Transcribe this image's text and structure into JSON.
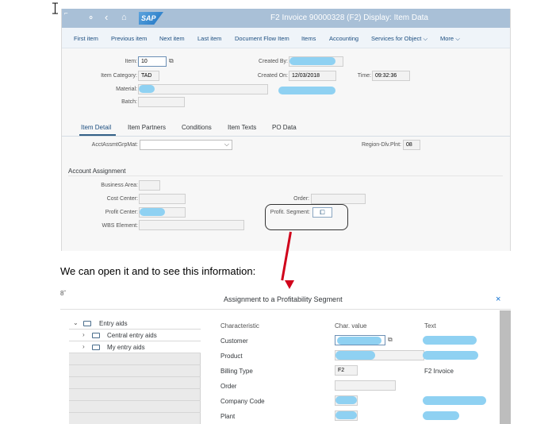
{
  "sap_window": {
    "title": "F2 Invoice 90000328 (F2) Display: Item Data",
    "logo_text": "SAP",
    "toolbar": [
      "First item",
      "Previous item",
      "Next item",
      "Last item",
      "Document Flow Item",
      "Items",
      "Accounting",
      "Services for Object",
      "More"
    ],
    "header": {
      "item_label": "Item:",
      "item_value": "10",
      "item_category_label": "Item Category:",
      "item_category_value": "TAD",
      "material_label": "Material:",
      "batch_label": "Batch:",
      "created_by_label": "Created By:",
      "created_on_label": "Created On:",
      "created_on_value": "12/03/2018",
      "time_label": "Time:",
      "time_value": "09:32:36"
    },
    "tabs": [
      "Item Detail",
      "Item Partners",
      "Conditions",
      "Item Texts",
      "PO Data"
    ],
    "active_tab": "Item Detail",
    "acct_assmt_label": "AcctAssmtGrpMat:",
    "region_label": "Region-Dlv.Plnt:",
    "region_value": "08",
    "account_assignment": {
      "title": "Account Assignment",
      "business_area_label": "Business Area:",
      "cost_center_label": "Cost Center:",
      "profit_center_label": "Profit Center:",
      "wbs_label": "WBS Element:",
      "order_label": "Order:",
      "profit_segment_label": "Profit. Segment:"
    }
  },
  "caption": "We can open it and to see this information:",
  "dialog": {
    "title": "Assignment to a Profitability Segment",
    "corner_glyph": "8ˇ",
    "close_glyph": "×",
    "tree": [
      {
        "label": "Entry aids",
        "level": 0,
        "expanded": true
      },
      {
        "label": "Central entry aids",
        "level": 1,
        "expanded": false
      },
      {
        "label": "My entry aids",
        "level": 1,
        "expanded": false
      }
    ],
    "columns": {
      "characteristic": "Characteristic",
      "char_value": "Char. value",
      "text": "Text"
    },
    "rows": [
      {
        "characteristic": "Customer",
        "value": "",
        "text": ""
      },
      {
        "characteristic": "Product",
        "value": "",
        "text": ""
      },
      {
        "characteristic": "Billing Type",
        "value": "F2",
        "text": "F2 Invoice"
      },
      {
        "characteristic": "Order",
        "value": "",
        "text": ""
      },
      {
        "characteristic": "Company Code",
        "value": "",
        "text": ""
      },
      {
        "characteristic": "Plant",
        "value": "",
        "text": ""
      }
    ]
  },
  "colors": {
    "shell_bar": "#a9c0d7",
    "link_blue": "#1c4e80",
    "arrow_red": "#d0021b",
    "redaction_blue": "#8fd1f2"
  }
}
